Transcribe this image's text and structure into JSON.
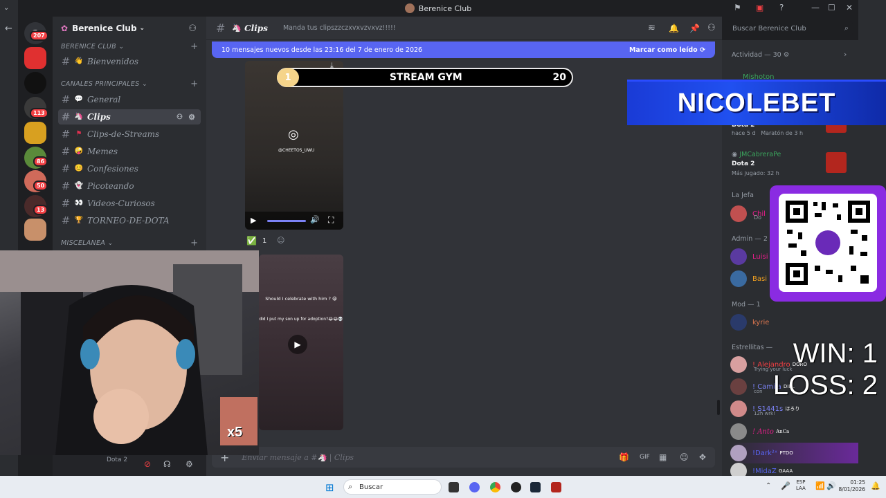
{
  "window": {
    "title": "Berenice Club"
  },
  "servers": {
    "badges": [
      "207",
      "113",
      "86",
      "50",
      "13"
    ]
  },
  "sidebar": {
    "server_name": "Berenice Club",
    "categories": [
      {
        "label": "BERENICE CLUB"
      },
      {
        "label": "CANALES PRINCIPALES"
      },
      {
        "label": "MISCELANEA"
      }
    ],
    "channels": [
      {
        "label": "Bienvenidos",
        "icon": "waving-hand"
      },
      {
        "label": "General",
        "icon": "speech-bubble"
      },
      {
        "label": "Clips",
        "icon": "unicorn"
      },
      {
        "label": "Clips-de-Streams",
        "icon": "red-flag"
      },
      {
        "label": "Memes",
        "icon": "laughing-face"
      },
      {
        "label": "Confesiones",
        "icon": "smiling-face"
      },
      {
        "label": "Picoteando",
        "icon": "ghost"
      },
      {
        "label": "Videos-Curiosos",
        "icon": "eyes"
      },
      {
        "label": "TORNEO-DE-DOTA",
        "icon": "trophy"
      }
    ],
    "user_status": "Dota 2"
  },
  "header": {
    "channel_name": "Clips",
    "topic": "Manda tus clipszzczxvxvzvxvz!!!!!",
    "search_placeholder": "Buscar Berenice Club"
  },
  "new_messages_bar": {
    "text": "10 mensajes nuevos desde las 23:16 del 7 de enero de 2026",
    "action": "Marcar como leído"
  },
  "messages": {
    "video1_caption": "@CHEETOS_UWU",
    "reaction_count": "1",
    "video2_text_1": "Should I celebrate with him ? 😀",
    "video2_text_2": "did I put my son up for adoption?😂😂💀"
  },
  "input": {
    "placeholder": "Enviar mensaje a #🦄 | Clips"
  },
  "members": {
    "activity_header": "Actividad — 30",
    "activity": [
      {
        "name": "Mishoton",
        "game": ""
      },
      {
        "name": "",
        "game": "Dota 2",
        "meta1": "hace 5 d",
        "meta2": "Maratón de 3 h"
      },
      {
        "name": "JMCabreraPe",
        "game": "Dota 2",
        "meta1": "Más jugado: 32 h"
      }
    ],
    "group_jefa": "La Jefa",
    "jefa_member": "Chil",
    "jefa_status": "Do",
    "group_admin": "Admin — 2",
    "admin_members": [
      {
        "name": "Luisi"
      },
      {
        "name": "Basi"
      }
    ],
    "group_mod": "Mod — 1",
    "mod_members": [
      {
        "name": "kyrie"
      }
    ],
    "group_estrellitas": "Estrellitas —",
    "estrellitas": [
      {
        "name": "! Alejandro",
        "tag": "DORO",
        "status": "Trying your luck"
      },
      {
        "name": "! Camila",
        "tag": "DIEL",
        "status": "con"
      },
      {
        "name": "! S1441s",
        "tag": "ほろり",
        "status": "12h wrk!"
      },
      {
        "name": "! Anto",
        "tag": "AnCa",
        "status": ""
      },
      {
        "name": "!Dark²ˣ",
        "tag": "PTDO",
        "status": ""
      },
      {
        "name": "!MidaZ",
        "tag": "GAAA",
        "status": ""
      }
    ]
  },
  "overlays": {
    "stream_gym_label": "STREAM GYM",
    "stream_gym_left": "1",
    "stream_gym_right": "20",
    "sponsor": "NICOLEBET",
    "win_text": "WIN: 1",
    "loss_text": "LOSS: 2",
    "multiplier": "x5"
  },
  "taskbar": {
    "search_placeholder": "Buscar",
    "lang_1": "ESP",
    "lang_2": "LAA",
    "time": "01:25",
    "date": "8/01/2026"
  },
  "colors": {
    "accent": "#5865f2",
    "background": "#313338",
    "sidebar": "#2b2d31",
    "rail": "#1e1f22"
  }
}
